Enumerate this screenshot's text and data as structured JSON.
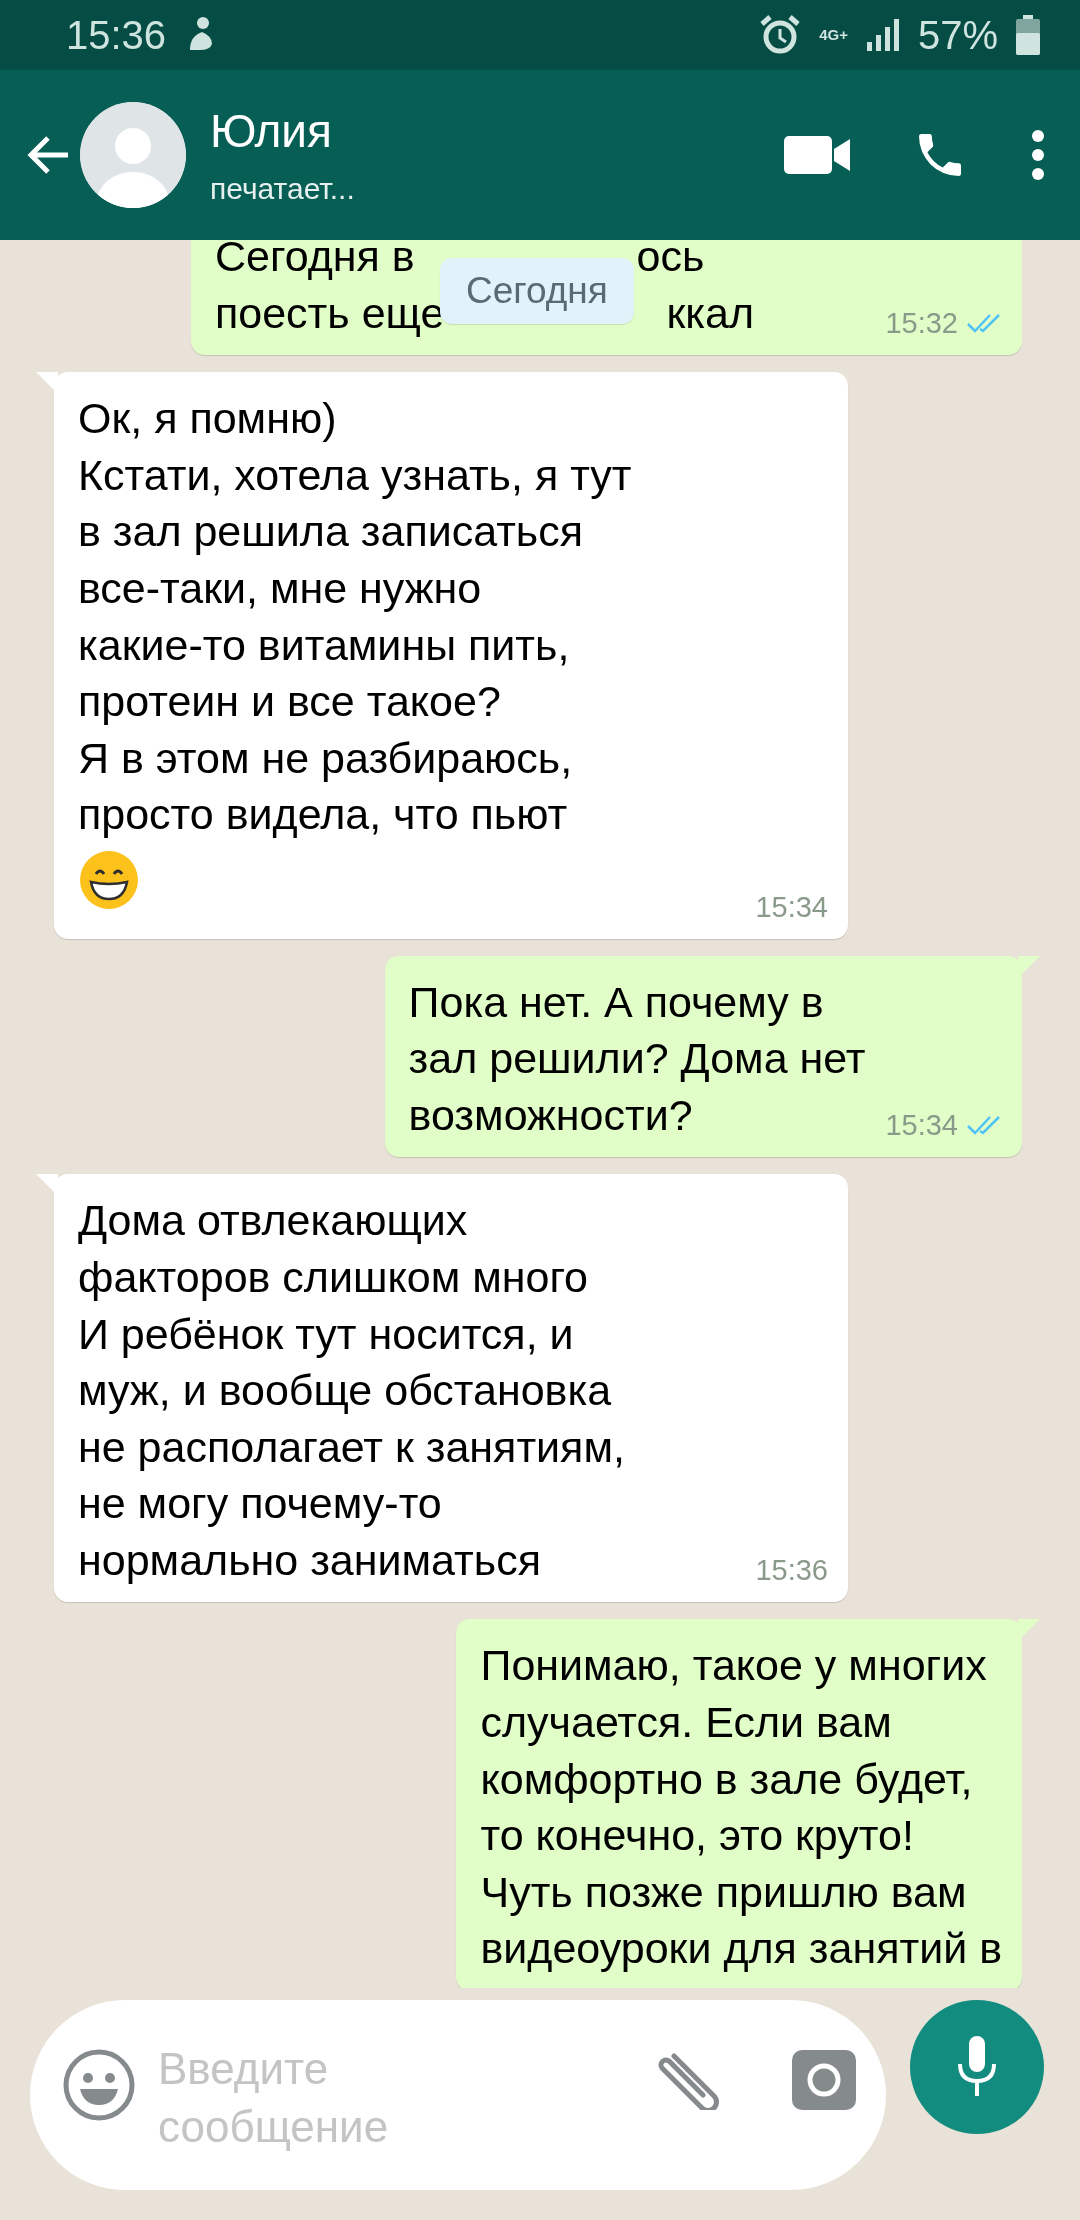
{
  "status_bar": {
    "time": "15:36",
    "network": "4G+",
    "battery": "57%"
  },
  "header": {
    "name": "Юлия",
    "status": "печатает..."
  },
  "date_chip": "Сегодня",
  "messages": [
    {
      "kind": "out",
      "fragments": [
        [
          "Сегодня в",
          "ось"
        ],
        [
          "поесть еще",
          "ккал"
        ]
      ],
      "time": "15:32",
      "read": true
    },
    {
      "kind": "in",
      "text": "Ок, я помню)\nКстати, хотела узнать, я тут\nв зал решила записаться\nвсе-таки, мне нужно\nкакие-то витамины пить,\nпротеин и все такое?\nЯ в этом не разбираюсь,\nпросто видела, что пьют",
      "emoji": true,
      "time": "15:34"
    },
    {
      "kind": "out",
      "text": "Пока нет. А почему в\nзал решили? Дома нет\nвозможности?",
      "time": "15:34",
      "read": true
    },
    {
      "kind": "in",
      "text": "Дома отвлекающих\nфакторов слишком много\nИ ребёнок тут носится, и\nмуж, и вообще обстановка\nне располагает к занятиям,\nне могу почему-то\nнормально заниматься",
      "time": "15:36"
    },
    {
      "kind": "out",
      "text": "Понимаю, такое у многих\nслучается. Если вам\nкомфортно в зале будет,\nто конечно, это круто!\nЧуть позже пришлю вам\nвидеоуроки для занятий в"
    }
  ],
  "input": {
    "placeholder": "Введите\nсообщение"
  }
}
